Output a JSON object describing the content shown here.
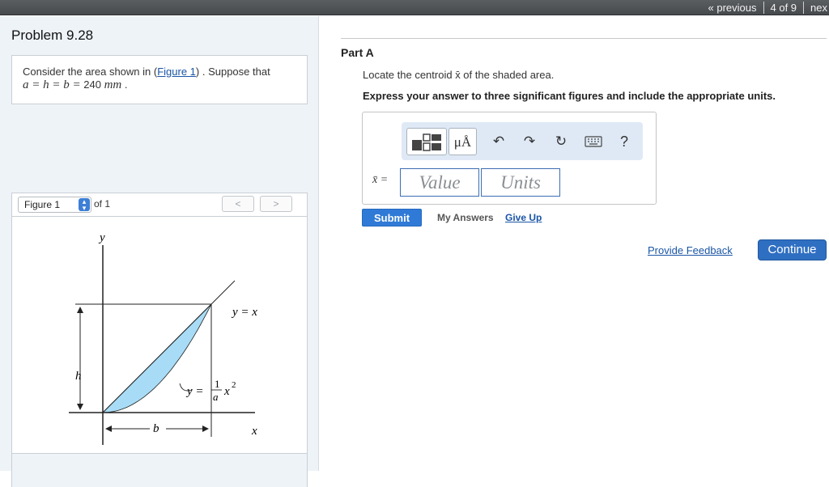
{
  "nav": {
    "previous": "« previous",
    "position": "4 of 9",
    "next": "nex"
  },
  "problem": {
    "title": "Problem 9.28",
    "statement_prefix": "Consider the area shown in (",
    "figure_link": "Figure 1",
    "statement_suffix": ") . Suppose that",
    "equation_vars": "a = h = b =",
    "equation_value": "240",
    "equation_unit": "mm",
    "equation_end": "."
  },
  "figure": {
    "selector_label": "Figure 1",
    "of_label": "of 1",
    "prev_glyph": "<",
    "next_glyph": ">",
    "labels": {
      "y_axis": "y",
      "x_axis": "x",
      "line_eq": "y = x",
      "curve_eq_lhs": "y =",
      "curve_eq_num": "1",
      "curve_eq_den": "a",
      "curve_eq_rhs": "x",
      "curve_eq_exp": "2",
      "h": "h",
      "b": "b"
    },
    "fill_color": "#a8dcf6"
  },
  "part": {
    "title": "Part A",
    "question": "Locate the centroid x̄ of the shaded area.",
    "instruction": "Express your answer to three significant figures and include the appropriate units."
  },
  "answer": {
    "variable_label": "x̄ =",
    "value_placeholder": "Value",
    "units_placeholder": "Units",
    "toolbar": {
      "units_glyph": "μÅ",
      "undo_glyph": "↶",
      "redo_glyph": "↷",
      "reset_glyph": "↻",
      "help_glyph": "?"
    }
  },
  "actions": {
    "submit": "Submit",
    "my_answers": "My Answers",
    "give_up": "Give Up",
    "provide_feedback": "Provide Feedback",
    "continue": "Continue"
  },
  "colors": {
    "accent": "#2f7ad6",
    "link": "#1a55a5",
    "panel_bg": "#eef3f8"
  }
}
